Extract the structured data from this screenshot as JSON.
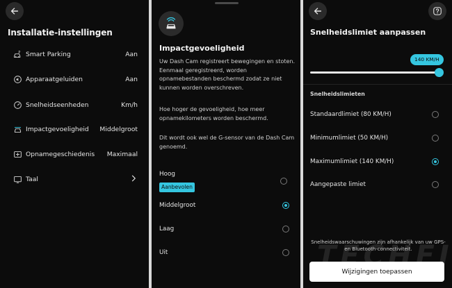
{
  "colors": {
    "accent": "#35c6e0",
    "background": "#0c0c0c",
    "text": "#e8e8e8",
    "button_bg": "#ffffff"
  },
  "settings_panel": {
    "title": "Installatie-instellingen",
    "back_icon": "arrow-left-icon",
    "items": [
      {
        "icon": "smart-parking-icon",
        "label": "Smart Parking",
        "value": "Aan"
      },
      {
        "icon": "speaker-icon",
        "label": "Apparaatgeluiden",
        "value": "Aan"
      },
      {
        "icon": "speedometer-icon",
        "label": "Snelheidseenheden",
        "value": "Km/h"
      },
      {
        "icon": "car-impact-icon",
        "label": "Impactgevoeligheid",
        "value": "Middelgroot"
      },
      {
        "icon": "recording-history-icon",
        "label": "Opnamegeschiedenis",
        "value": "Maximaal"
      },
      {
        "icon": "language-icon",
        "label": "Taal",
        "value": ""
      }
    ]
  },
  "impact_panel": {
    "title": "Impactgevoeligheid",
    "paragraphs": [
      "Uw Dash Cam registreert bewegingen en stoten. Eenmaal geregistreerd, worden opnamebestanden beschermd zodat ze niet kunnen worden overschreven.",
      "Hoe hoger de gevoeligheid, hoe meer opnamekilometers worden beschermd.",
      "Dit wordt ook wel de G-sensor van de Dash Cam genoemd."
    ],
    "options": [
      {
        "label": "Hoog",
        "selected": false
      },
      {
        "label": "Middelgroot",
        "selected": true
      },
      {
        "label": "Laag",
        "selected": false
      },
      {
        "label": "Uit",
        "selected": false
      }
    ],
    "recommended_badge": "Aanbevolen"
  },
  "speed_panel": {
    "title": "Snelheidslimiet aanpassen",
    "slider_value_label": "140 KM/H",
    "slider_fraction": 1.0,
    "section_label": "Snelheidslimieten",
    "options": [
      {
        "label": "Standaardlimiet (80 KM/H)",
        "selected": false
      },
      {
        "label": "Minimumlimiet (50 KM/H)",
        "selected": false
      },
      {
        "label": "Maximumlimiet (140 KM/H)",
        "selected": true
      },
      {
        "label": "Aangepaste limiet",
        "selected": false
      }
    ],
    "footnote": "Snelheidswaarschuwingen zijn afhankelijk van uw GPS- en Bluetooth-connectiviteit.",
    "apply_label": "Wijzigingen toepassen",
    "watermark": "TECHFI"
  }
}
